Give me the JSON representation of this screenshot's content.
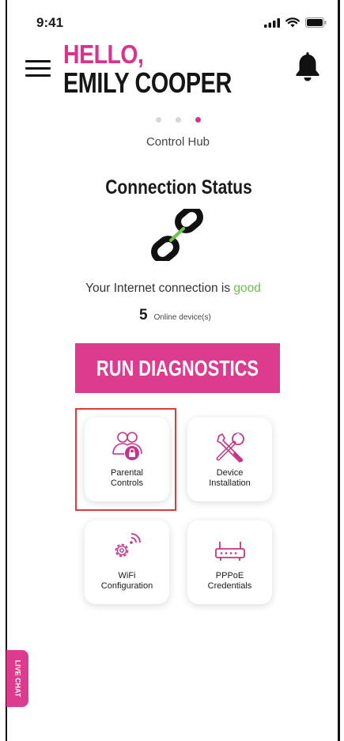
{
  "status_bar": {
    "time": "9:41"
  },
  "header": {
    "greeting": "HELLO,",
    "name": "EMILY COOPER"
  },
  "pager": {
    "label": "Control Hub"
  },
  "connection": {
    "title": "Connection Status",
    "message_prefix": "Your Internet connection is",
    "status_word": "good",
    "device_count": "5",
    "device_label": "Online device(s)"
  },
  "actions": {
    "diagnostics_label": "RUN DIAGNOSTICS"
  },
  "tiles": {
    "parental": {
      "line1": "Parental",
      "line2": "Controls"
    },
    "device": {
      "line1": "Device",
      "line2": "Installation"
    },
    "wifi": {
      "line1": "WiFi",
      "line2": "Configuration"
    },
    "pppoe": {
      "line1": "PPPoE",
      "line2": "Credentials"
    }
  },
  "live_chat": {
    "label": "LIVE CHAT"
  },
  "colors": {
    "accent": "#dc3b8e",
    "good": "#6cc24a",
    "highlight": "#e23a3a"
  }
}
